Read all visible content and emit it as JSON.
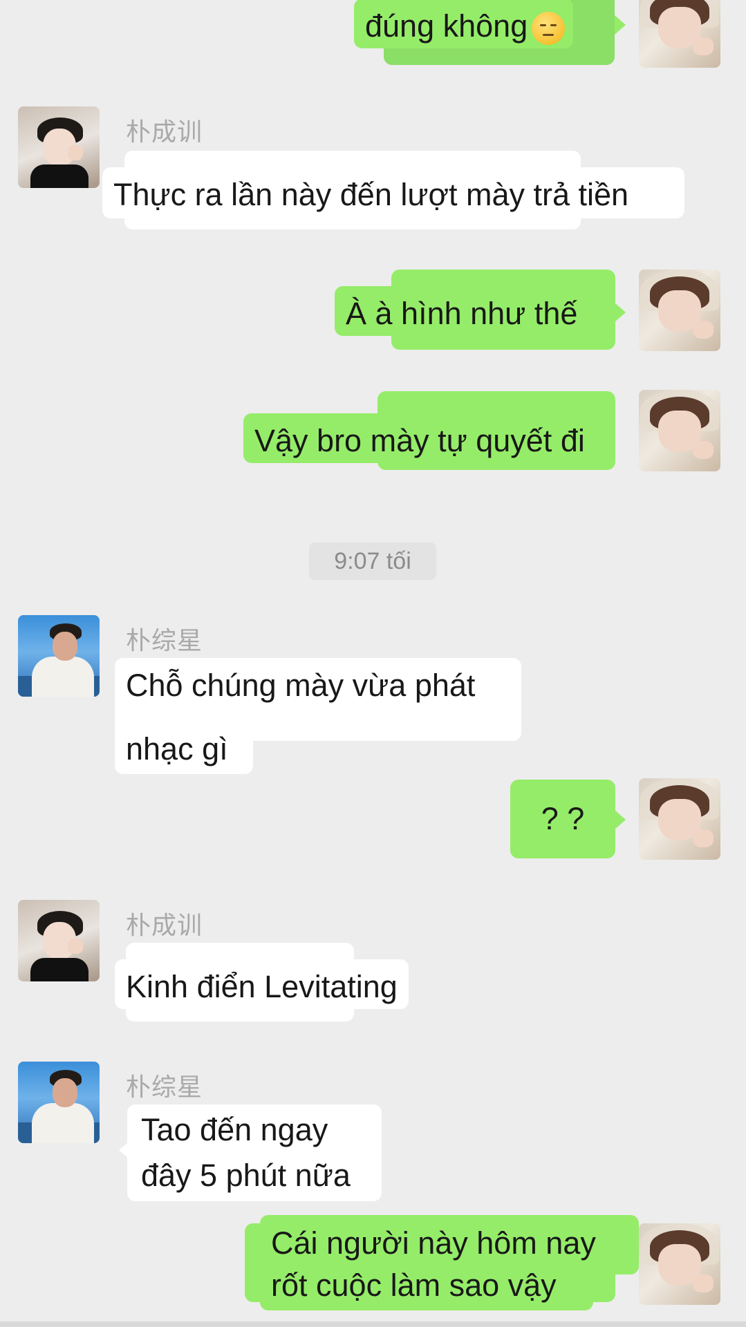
{
  "messages": [
    {
      "id": "m1",
      "side": "right",
      "text": "đúng không",
      "emoji": "pensive-face"
    },
    {
      "id": "m2",
      "side": "left",
      "sender": "朴成训",
      "text": "Thực ra lần này đến lượt mày trả tiền"
    },
    {
      "id": "m3",
      "side": "right",
      "text": "À à hình như thế"
    },
    {
      "id": "m4",
      "side": "right",
      "text": "Vậy bro mày tự quyết đi"
    },
    {
      "id": "m5",
      "side": "left",
      "sender": "朴综星",
      "lines": [
        "Chỗ chúng mày vừa phát",
        "nhạc gì"
      ]
    },
    {
      "id": "m6",
      "side": "right",
      "text": "? ?"
    },
    {
      "id": "m7",
      "side": "left",
      "sender": "朴成训",
      "text": "Kinh điển Levitating"
    },
    {
      "id": "m8",
      "side": "left",
      "sender": "朴综星",
      "lines": [
        "Tao đến ngay",
        "đây 5 phút nữa"
      ]
    },
    {
      "id": "m9",
      "side": "right",
      "lines": [
        "Cái người này hôm nay",
        "rốt cuộc làm sao vậy"
      ]
    }
  ],
  "timestamp": "9:07 tối",
  "colors": {
    "background": "#ededed",
    "outgoing_bubble": "#95ec69",
    "incoming_bubble": "#ffffff",
    "sender_name": "#a9a9a9"
  }
}
